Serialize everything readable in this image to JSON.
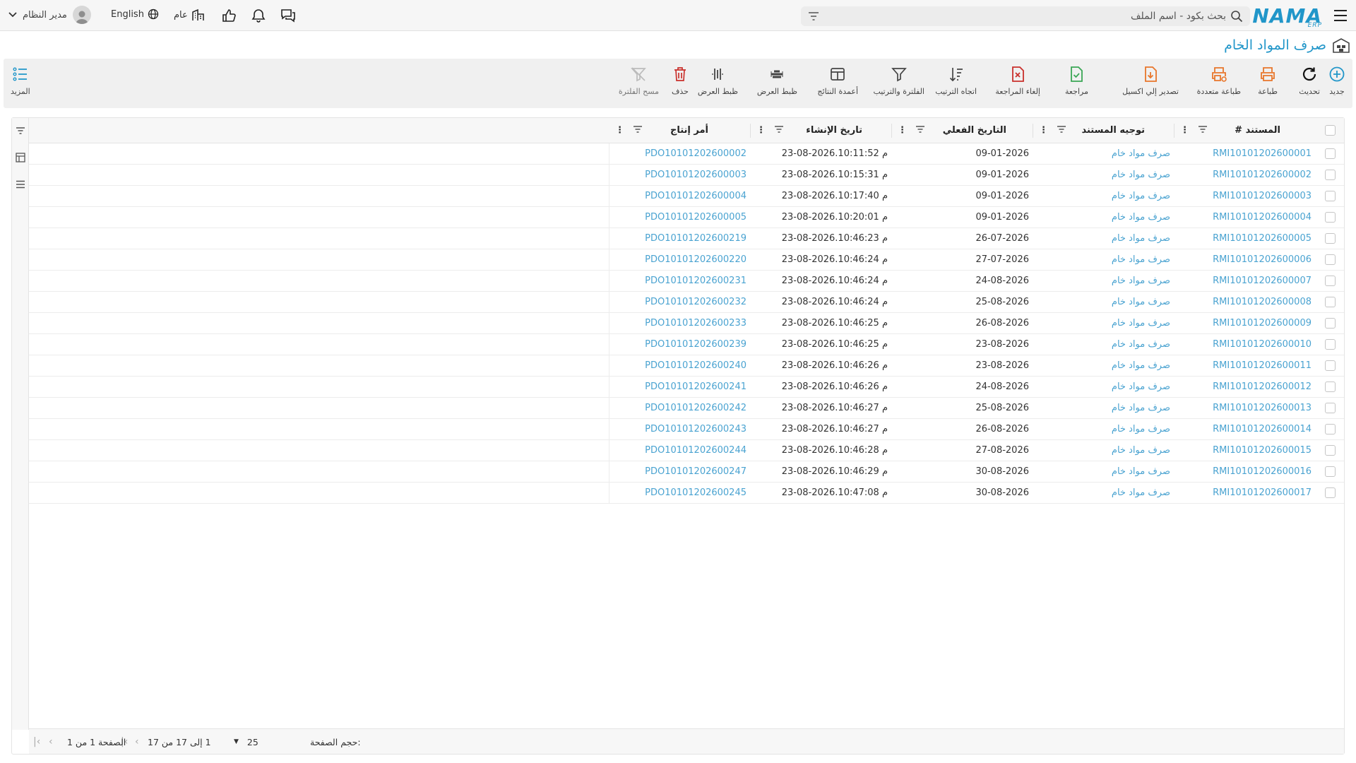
{
  "header": {
    "logo": "NAMA",
    "logo_sub": "ERP",
    "search_placeholder": "بحث بكود - اسم الملف",
    "language": "English",
    "branch": "عام",
    "user_name": "مدير النظام"
  },
  "page": {
    "title": "صرف المواد الخام"
  },
  "toolbar": {
    "new": "جديد",
    "refresh": "تحديث",
    "print": "طباعة",
    "multi_print": "طباعة متعددة",
    "export_excel": "تصدير إلي اكسيل",
    "review": "مراجعة",
    "cancel_review": "إلغاء المراجعة",
    "sort_direction": "اتجاه الترتيب",
    "filter_sort": "الفلترة والترتيب",
    "result_columns": "أعمدة النتائج",
    "view_settings_1": "ظبط العرض",
    "view_settings_2": "ظبط العرض",
    "delete": "حذف",
    "clear_filter": "مسح الفلترة",
    "more": "المزيد"
  },
  "grid": {
    "columns": {
      "document": "# المستند",
      "routing": "توجيه المستند",
      "actual_date": "التاريخ الفعلي",
      "created_date": "تاريخ الإنشاء",
      "production_order": "أمر إنتاج"
    },
    "rows": [
      {
        "doc": "RMI10101202600001",
        "routing": "صرف مواد خام",
        "actual": "09-01-2026",
        "created": "23-08-2026.10:11:52 م",
        "po": "PDO10101202600002"
      },
      {
        "doc": "RMI10101202600002",
        "routing": "صرف مواد خام",
        "actual": "09-01-2026",
        "created": "23-08-2026.10:15:31 م",
        "po": "PDO10101202600003"
      },
      {
        "doc": "RMI10101202600003",
        "routing": "صرف مواد خام",
        "actual": "09-01-2026",
        "created": "23-08-2026.10:17:40 م",
        "po": "PDO10101202600004"
      },
      {
        "doc": "RMI10101202600004",
        "routing": "صرف مواد خام",
        "actual": "09-01-2026",
        "created": "23-08-2026.10:20:01 م",
        "po": "PDO10101202600005"
      },
      {
        "doc": "RMI10101202600005",
        "routing": "صرف مواد خام",
        "actual": "26-07-2026",
        "created": "23-08-2026.10:46:23 م",
        "po": "PDO10101202600219"
      },
      {
        "doc": "RMI10101202600006",
        "routing": "صرف مواد خام",
        "actual": "27-07-2026",
        "created": "23-08-2026.10:46:24 م",
        "po": "PDO10101202600220"
      },
      {
        "doc": "RMI10101202600007",
        "routing": "صرف مواد خام",
        "actual": "24-08-2026",
        "created": "23-08-2026.10:46:24 م",
        "po": "PDO10101202600231"
      },
      {
        "doc": "RMI10101202600008",
        "routing": "صرف مواد خام",
        "actual": "25-08-2026",
        "created": "23-08-2026.10:46:24 م",
        "po": "PDO10101202600232"
      },
      {
        "doc": "RMI10101202600009",
        "routing": "صرف مواد خام",
        "actual": "26-08-2026",
        "created": "23-08-2026.10:46:25 م",
        "po": "PDO10101202600233"
      },
      {
        "doc": "RMI10101202600010",
        "routing": "صرف مواد خام",
        "actual": "23-08-2026",
        "created": "23-08-2026.10:46:25 م",
        "po": "PDO10101202600239"
      },
      {
        "doc": "RMI10101202600011",
        "routing": "صرف مواد خام",
        "actual": "23-08-2026",
        "created": "23-08-2026.10:46:26 م",
        "po": "PDO10101202600240"
      },
      {
        "doc": "RMI10101202600012",
        "routing": "صرف مواد خام",
        "actual": "24-08-2026",
        "created": "23-08-2026.10:46:26 م",
        "po": "PDO10101202600241"
      },
      {
        "doc": "RMI10101202600013",
        "routing": "صرف مواد خام",
        "actual": "25-08-2026",
        "created": "23-08-2026.10:46:27 م",
        "po": "PDO10101202600242"
      },
      {
        "doc": "RMI10101202600014",
        "routing": "صرف مواد خام",
        "actual": "26-08-2026",
        "created": "23-08-2026.10:46:27 م",
        "po": "PDO10101202600243"
      },
      {
        "doc": "RMI10101202600015",
        "routing": "صرف مواد خام",
        "actual": "27-08-2026",
        "created": "23-08-2026.10:46:28 م",
        "po": "PDO10101202600244"
      },
      {
        "doc": "RMI10101202600016",
        "routing": "صرف مواد خام",
        "actual": "30-08-2026",
        "created": "23-08-2026.10:46:29 م",
        "po": "PDO10101202600247"
      },
      {
        "doc": "RMI10101202600017",
        "routing": "صرف مواد خام",
        "actual": "30-08-2026",
        "created": "23-08-2026.10:47:08 م",
        "po": "PDO10101202600245"
      }
    ]
  },
  "footer": {
    "page_size_label": "حجم الصفحة:",
    "page_size_value": "25",
    "range_text": "1 إلى 17 من 17",
    "page_text": "الصفحة 1 من 1"
  },
  "colors": {
    "accent": "#2196c9",
    "link": "#4aa3d1",
    "orange": "#e8762b",
    "green": "#3aa655",
    "red": "#c9302c"
  }
}
